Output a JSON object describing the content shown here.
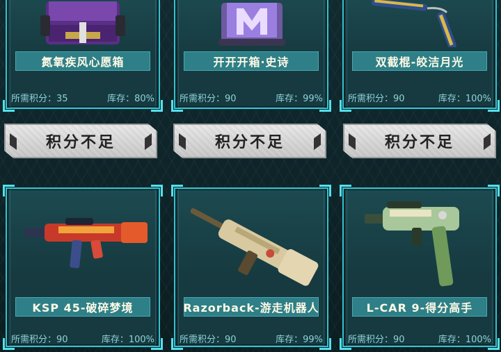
{
  "row1": [
    {
      "name": "氮氧疾风心愿箱",
      "points_label": "所需积分：35",
      "stock_label": "库存：80%",
      "art": "purple-supply-crate-icon"
    },
    {
      "name": "开开开箱·史诗",
      "points_label": "所需积分：90",
      "stock_label": "库存：99%",
      "art": "purple-epic-box-icon"
    },
    {
      "name": "双截棍-皎洁月光",
      "points_label": "所需积分：90",
      "stock_label": "库存：100%",
      "art": "nunchaku-icon"
    }
  ],
  "buttons": [
    "积分不足",
    "积分不足",
    "积分不足"
  ],
  "row2": [
    {
      "name": "KSP 45-破碎梦境",
      "points_label": "所需积分：90",
      "stock_label": "库存：100%",
      "art": "ksp45-smg-icon"
    },
    {
      "name": "Razorback-游走机器人",
      "points_label": "所需积分：90",
      "stock_label": "库存：99%",
      "art": "razorback-rifle-icon"
    },
    {
      "name": "L-CAR 9-得分高手",
      "points_label": "所需积分：90",
      "stock_label": "库存：100%",
      "art": "lcar9-pistol-icon"
    }
  ],
  "colors": {
    "accent": "#35c1cf",
    "name_bar": "#2e7f87",
    "button": "#d6d6d6",
    "stat_text": "#8fd3da"
  }
}
